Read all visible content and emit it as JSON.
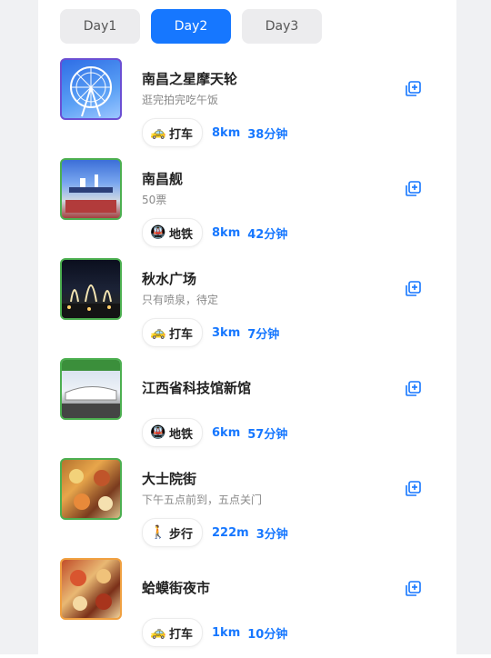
{
  "tabs": [
    {
      "label": "Day1",
      "active": false
    },
    {
      "label": "Day2",
      "active": true
    },
    {
      "label": "Day3",
      "active": false
    }
  ],
  "items": [
    {
      "title": "南昌之星摩天轮",
      "subtitle": "逛完拍完吃午饭",
      "mode_icon": "🚕",
      "mode": "打车",
      "distance": "8km",
      "duration": "38分钟"
    },
    {
      "title": "南昌舰",
      "subtitle": "50票",
      "mode_icon": "🚇",
      "mode": "地铁",
      "distance": "8km",
      "duration": "42分钟"
    },
    {
      "title": "秋水广场",
      "subtitle": "只有喷泉，待定",
      "mode_icon": "🚕",
      "mode": "打车",
      "distance": "3km",
      "duration": "7分钟"
    },
    {
      "title": "江西省科技馆新馆",
      "subtitle": "",
      "mode_icon": "🚇",
      "mode": "地铁",
      "distance": "6km",
      "duration": "57分钟"
    },
    {
      "title": "大士院街",
      "subtitle": "下午五点前到，五点关门",
      "mode_icon": "🚶",
      "mode": "步行",
      "distance": "222m",
      "duration": "3分钟"
    },
    {
      "title": "蛤蟆街夜市",
      "subtitle": "",
      "mode_icon": "🚕",
      "mode": "打车",
      "distance": "1km",
      "duration": "10分钟"
    }
  ],
  "colors": {
    "accent": "#1677ff"
  }
}
